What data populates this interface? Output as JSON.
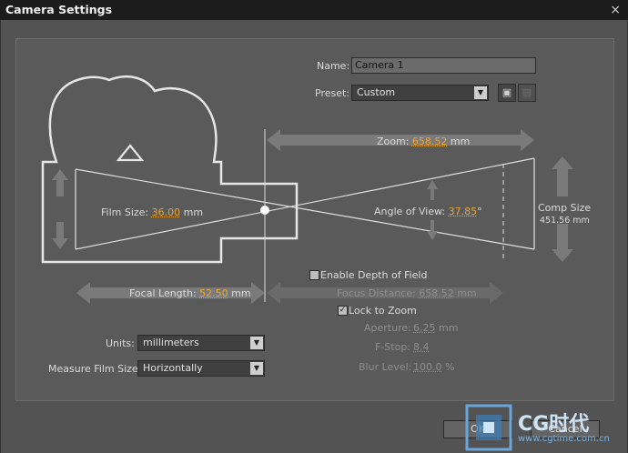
{
  "window": {
    "title": "Camera Settings",
    "close_label": "×"
  },
  "name": {
    "label": "Name:",
    "value": "Camera 1"
  },
  "preset": {
    "label": "Preset:",
    "value": "Custom",
    "save_icon": "floppy-icon",
    "delete_icon": "trash-icon"
  },
  "zoom": {
    "label": "Zoom:",
    "value": "658.52",
    "unit": "mm"
  },
  "film_size": {
    "label": "Film Size:",
    "value": "36.00",
    "unit": "mm"
  },
  "angle_of_view": {
    "label": "Angle of View:",
    "value": "37.85",
    "unit": "°"
  },
  "comp_size": {
    "label": "Comp Size",
    "value": "451.56 mm"
  },
  "focal_length": {
    "label": "Focal Length:",
    "value": "52.50",
    "unit": "mm"
  },
  "depth_of_field": {
    "enable_label": "Enable Depth of Field",
    "enabled": false,
    "focus_distance_label": "Focus Distance:",
    "focus_distance_value": "658.52",
    "focus_distance_unit": "mm",
    "lock_to_zoom_label": "Lock to Zoom",
    "lock_to_zoom": true,
    "aperture_label": "Aperture:",
    "aperture_value": "6.25",
    "aperture_unit": "mm",
    "fstop_label": "F-Stop:",
    "fstop_value": "8.4",
    "blur_label": "Blur Level:",
    "blur_value": "100.0",
    "blur_unit": "%"
  },
  "units": {
    "label": "Units:",
    "value": "millimeters"
  },
  "measure_film_size": {
    "label": "Measure Film Size:",
    "value": "Horizontally"
  },
  "buttons": {
    "ok": "OK",
    "cancel": "Cancel"
  },
  "watermark": {
    "text": "CG时代",
    "url": "www.cgtime.com.cn"
  },
  "colors": {
    "accent": "#e8a536",
    "panel": "#5a5a5a",
    "titlebar": "#1c1c1c"
  }
}
